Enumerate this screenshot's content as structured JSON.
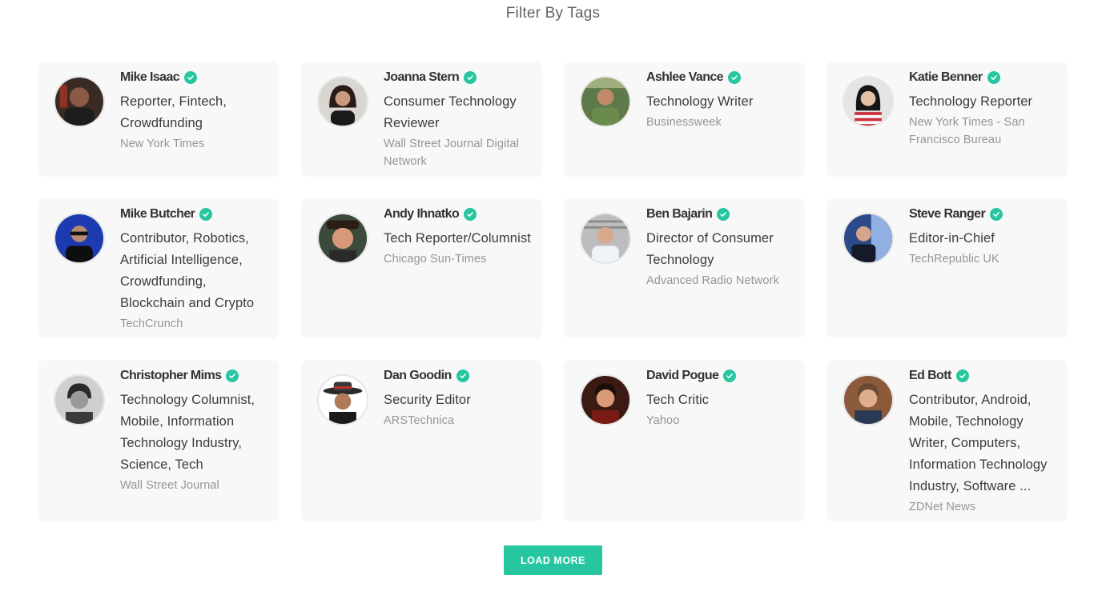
{
  "header": {
    "title": "Filter By Tags"
  },
  "accent_color": "#26c6a0",
  "cards": [
    {
      "name": "Mike Isaac",
      "role": "Reporter, Fintech, Crowdfunding",
      "outlet": "New York Times",
      "avatar_icon": "avatar-photo",
      "verified_icon": "check-circle-icon"
    },
    {
      "name": "Joanna Stern",
      "role": "Consumer Technology Reviewer",
      "outlet": "Wall Street Journal Digital Network",
      "avatar_icon": "avatar-photo",
      "verified_icon": "check-circle-icon"
    },
    {
      "name": "Ashlee Vance",
      "role": "Technology Writer",
      "outlet": "Businessweek",
      "avatar_icon": "avatar-photo",
      "verified_icon": "check-circle-icon"
    },
    {
      "name": "Katie Benner",
      "role": "Technology Reporter",
      "outlet": "New York Times - San Francisco Bureau",
      "avatar_icon": "avatar-photo",
      "verified_icon": "check-circle-icon"
    },
    {
      "name": "Mike Butcher",
      "role": "Contributor, Robotics, Artificial Intelligence, Crowdfunding, Blockchain and Crypto",
      "outlet": "TechCrunch",
      "avatar_icon": "avatar-photo",
      "verified_icon": "check-circle-icon"
    },
    {
      "name": "Andy Ihnatko",
      "role": "Tech Reporter/Columnist",
      "outlet": "Chicago Sun-Times",
      "avatar_icon": "avatar-photo",
      "verified_icon": "check-circle-icon"
    },
    {
      "name": "Ben Bajarin",
      "role": "Director of Consumer Technology",
      "outlet": "Advanced Radio Network",
      "avatar_icon": "avatar-photo",
      "verified_icon": "check-circle-icon"
    },
    {
      "name": "Steve Ranger",
      "role": "Editor-in-Chief",
      "outlet": "TechRepublic UK",
      "avatar_icon": "avatar-photo",
      "verified_icon": "check-circle-icon"
    },
    {
      "name": "Christopher Mims",
      "role": "Technology Columnist, Mobile, Information Technology Industry, Science, Tech",
      "outlet": "Wall Street Journal",
      "avatar_icon": "avatar-photo",
      "verified_icon": "check-circle-icon"
    },
    {
      "name": "Dan Goodin",
      "role": "Security Editor",
      "outlet": "ARSTechnica",
      "avatar_icon": "avatar-photo",
      "verified_icon": "check-circle-icon"
    },
    {
      "name": "David Pogue",
      "role": "Tech Critic",
      "outlet": "Yahoo",
      "avatar_icon": "avatar-photo",
      "verified_icon": "check-circle-icon"
    },
    {
      "name": "Ed Bott",
      "role": "Contributor, Android, Mobile, Technology Writer, Computers, Information Technology Industry, Software ...",
      "outlet": "ZDNet News",
      "avatar_icon": "avatar-photo",
      "verified_icon": "check-circle-icon"
    }
  ],
  "load_more": {
    "label": "LOAD MORE"
  }
}
